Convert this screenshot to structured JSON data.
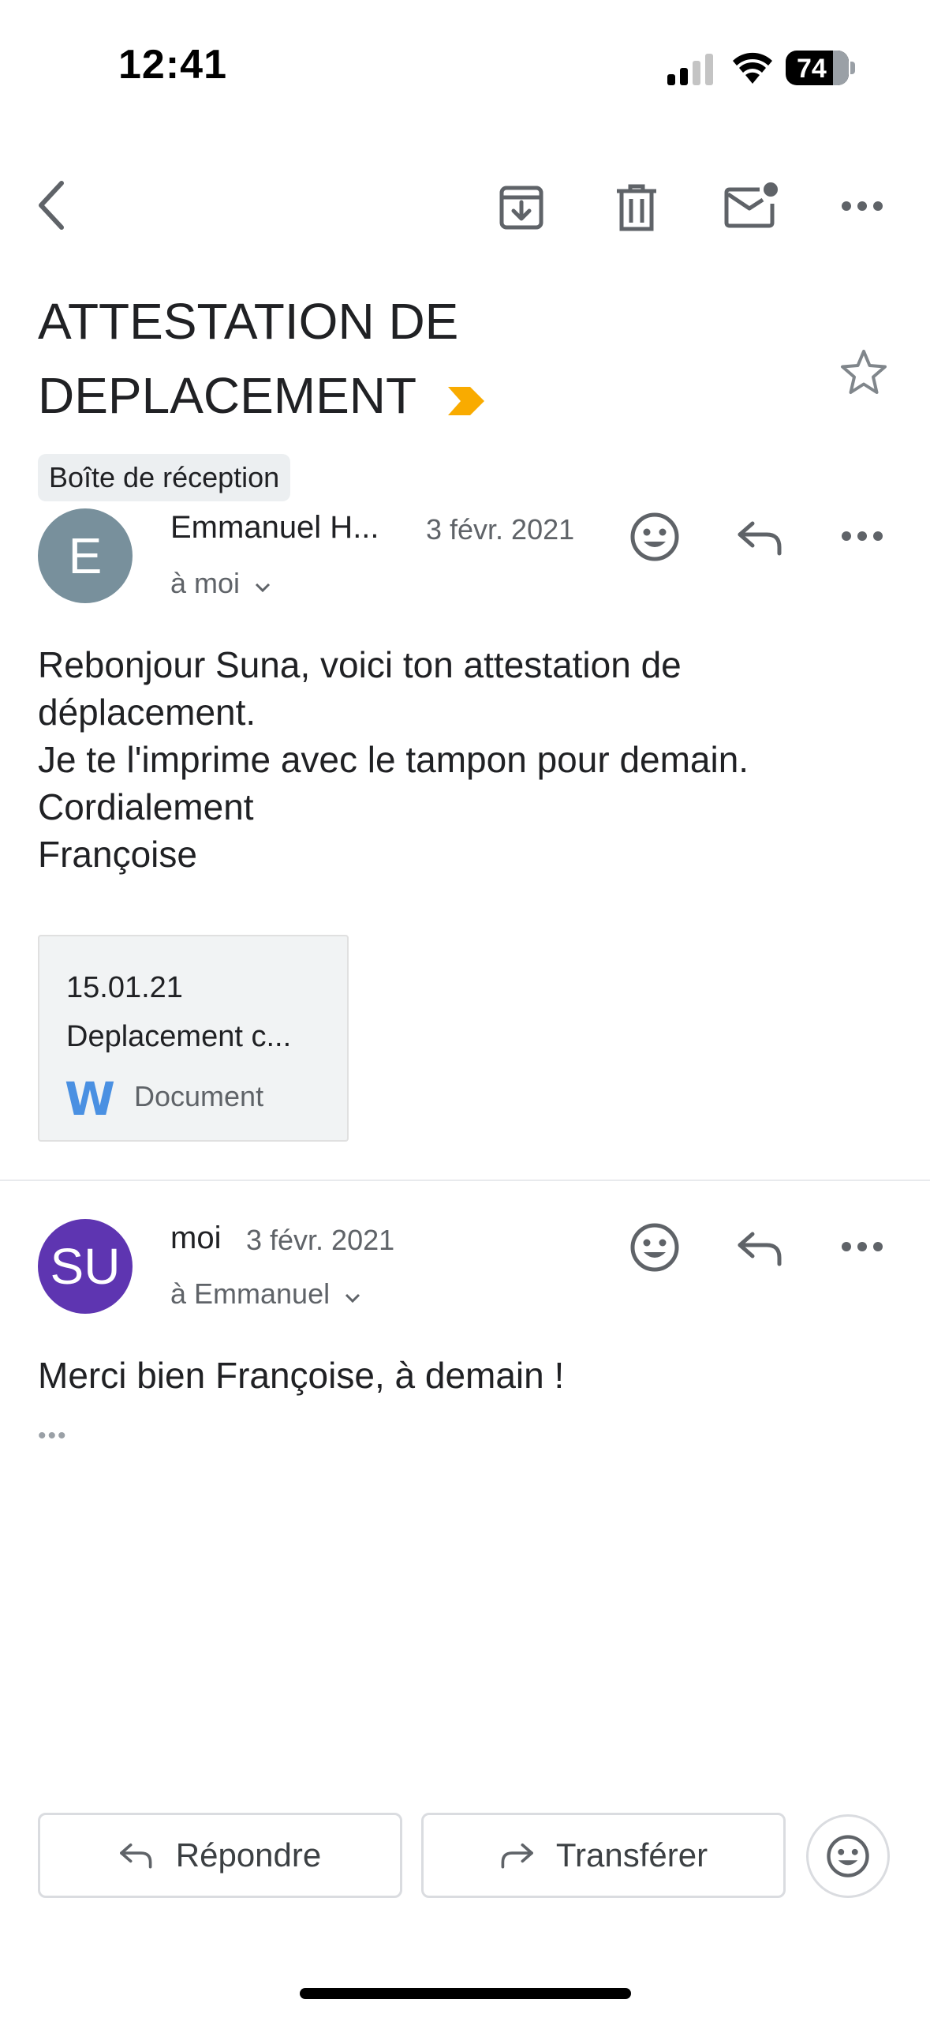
{
  "status_bar": {
    "time": "12:41",
    "battery": "74"
  },
  "toolbar": {
    "back": "back-arrow-icon",
    "archive": "archive-icon",
    "delete": "trash-icon",
    "mark_unread": "mail-unread-icon",
    "more": "more-horizontal-icon"
  },
  "subject": {
    "line1": "ATTESTATION DE",
    "line2": "DEPLACEMENT",
    "label": "Boîte de réception",
    "important_color": "#F9AB00"
  },
  "messages": [
    {
      "avatar_initials": "E",
      "avatar_color": "#78909C",
      "sender": "Emmanuel H...",
      "date": "3 févr. 2021",
      "to": "à moi",
      "body": "Rebonjour  Suna,  voici ton attestation de\ndéplacement.\nJe te l'imprime avec le tampon pour demain.\nCordialement\nFrançoise",
      "attachment": {
        "line1": "15.01.21",
        "line2": "Deplacement c...",
        "type": "Document",
        "type_icon": "word-doc-icon"
      }
    },
    {
      "avatar_initials": "SU",
      "avatar_color": "#5E35B1",
      "sender": "moi",
      "date": "3 févr. 2021",
      "to": "à Emmanuel",
      "body": "Merci bien Françoise, à demain !",
      "collapsed": "•••"
    }
  ],
  "actions": {
    "reply": "Répondre",
    "forward": "Transférer"
  }
}
